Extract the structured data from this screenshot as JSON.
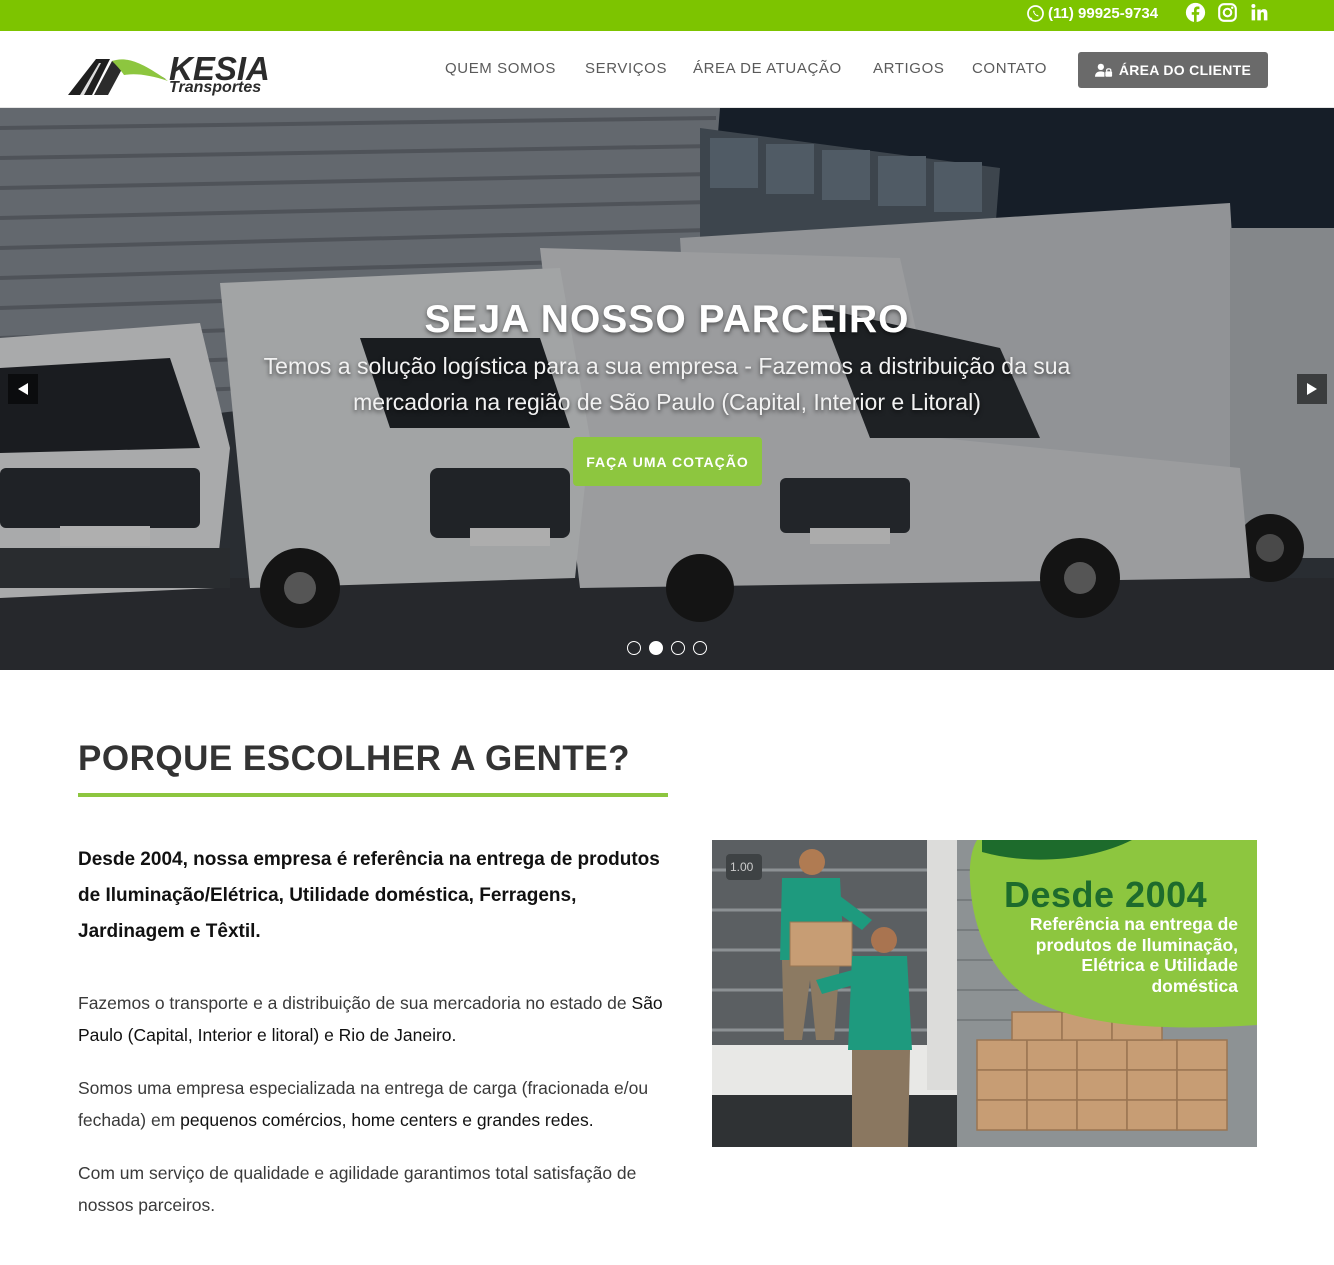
{
  "topbar": {
    "phone": "(11) 99925-9734",
    "social": [
      "facebook-icon",
      "instagram-icon",
      "linkedin-icon"
    ],
    "bg_color": "#7dc400"
  },
  "header": {
    "logo_text": "KESIA",
    "logo_sub": "Transportes",
    "nav": [
      "QUEM SOMOS",
      "SERVIÇOS",
      "ÁREA DE ATUAÇÃO",
      "ARTIGOS",
      "CONTATO"
    ],
    "client_button": "ÁREA DO CLIENTE"
  },
  "hero": {
    "title": "SEJA NOSSO PARCEIRO",
    "subtitle": "Temos a solução logística para a sua empresa - Fazemos a distribuição da sua mercadoria na região de São Paulo (Capital, Interior e Litoral)",
    "cta": "FAÇA UMA COTAÇÃO",
    "slides": 4,
    "active_slide": 2
  },
  "section": {
    "title": "PORQUE ESCOLHER A GENTE?",
    "lead": "Desde 2004, nossa empresa é referência na entrega de produtos de Iluminação/Elétrica, Utilidade doméstica, Ferragens, Jardinagem e Têxtil.",
    "p1_a": "Fazemos o transporte e a distribuição de sua mercadoria no estado de ",
    "p1_b": "São Paulo (Capital, Interior e litoral) e Rio de Janeiro.",
    "p2_a": "Somos uma empresa especializada na entrega de carga (fracionada e/ou fechada) em ",
    "p2_b": "pequenos comércios, home centers e grandes redes.",
    "p3": "Com um serviço de qualidade e agilidade garantimos total satisfação de nossos parceiros."
  },
  "promo": {
    "year": "Desde 2004",
    "tagline": "Referência na entrega de produtos de Iluminação, Elétrica e Utilidade doméstica",
    "sign": "1.00"
  },
  "colors": {
    "accent": "#8dc63f",
    "dark_green": "#1d6b2c"
  }
}
